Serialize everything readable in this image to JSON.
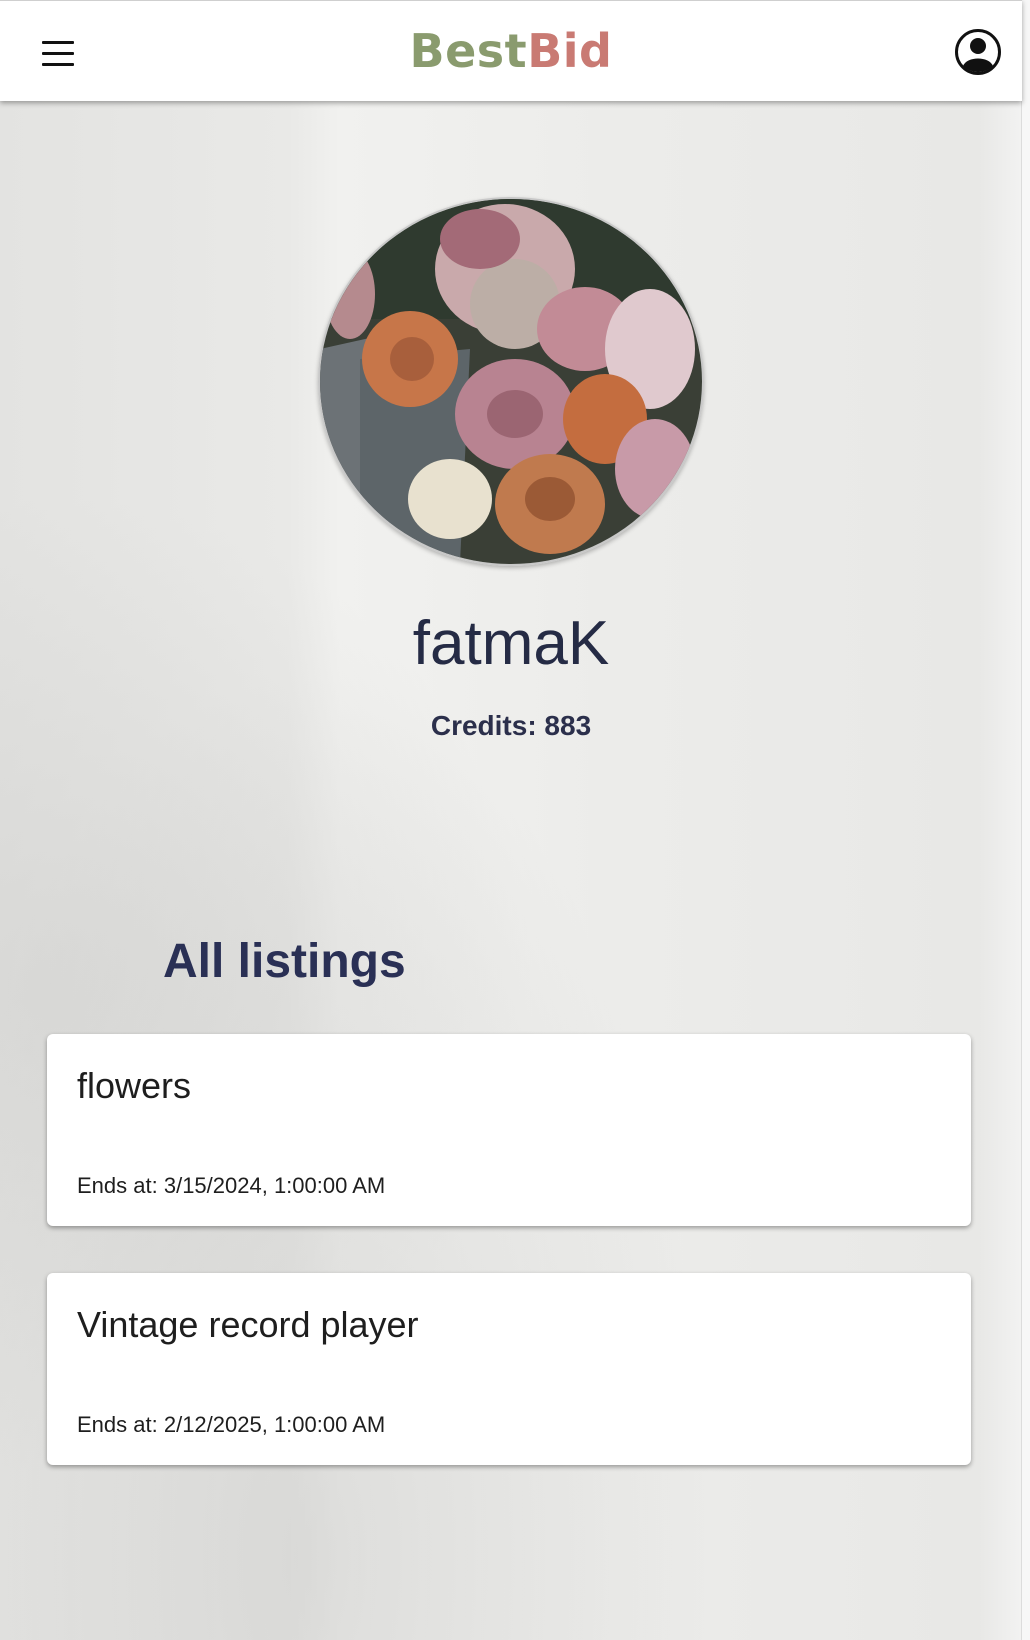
{
  "header": {
    "logo_best": "Best",
    "logo_bid": "Bid",
    "menu_icon": "hamburger-menu-icon",
    "profile_icon": "user-circle-icon"
  },
  "profile": {
    "username": "fatmaK",
    "credits_label": "Credits:",
    "credits_value": "883",
    "avatar_description_icon": "flower-bouquet-avatar"
  },
  "listings_section": {
    "title": "All listings",
    "items": [
      {
        "title": "flowers",
        "ends_label": "Ends at:",
        "ends_value": "3/15/2024, 1:00:00 AM"
      },
      {
        "title": "Vintage record player",
        "ends_label": "Ends at:",
        "ends_value": "2/12/2025, 1:00:00 AM"
      }
    ]
  },
  "colors": {
    "logo_best": "#8a9b6e",
    "logo_bid": "#c97a73",
    "heading": "#2a3055",
    "text": "#1e1e1e"
  }
}
